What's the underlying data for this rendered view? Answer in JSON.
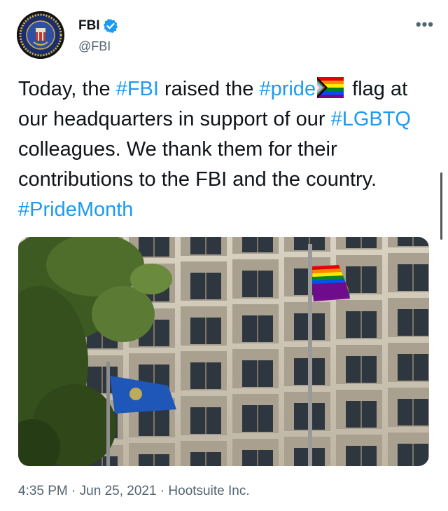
{
  "author": {
    "name": "FBI",
    "handle": "@FBI",
    "avatar_icon": "fbi-seal-icon",
    "verified_icon": "verified-badge-icon"
  },
  "menu": {
    "more_label": "•••"
  },
  "tweet": {
    "segments": [
      {
        "text": "Today, the ",
        "hashtag": false
      },
      {
        "text": "#FBI",
        "hashtag": true
      },
      {
        "text": " raised the ",
        "hashtag": false
      },
      {
        "text": "#pride",
        "hashtag": true
      },
      {
        "text": " flag at our headquarters in support of our ",
        "hashtag": false
      },
      {
        "text": "#LGBTQ",
        "hashtag": true
      },
      {
        "text": " colleagues. We thank them for their contributions to the FBI and the country. ",
        "hashtag": false
      },
      {
        "text": "#PrideMonth",
        "hashtag": true
      }
    ]
  },
  "photo": {
    "description_icon": "building-flags-photo"
  },
  "meta": {
    "time": "4:35 PM",
    "date": "Jun 25, 2021",
    "source": "Hootsuite Inc.",
    "separator": "·"
  },
  "colors": {
    "link": "#1d9bf0",
    "text": "#0f1419",
    "secondary": "#536471"
  }
}
